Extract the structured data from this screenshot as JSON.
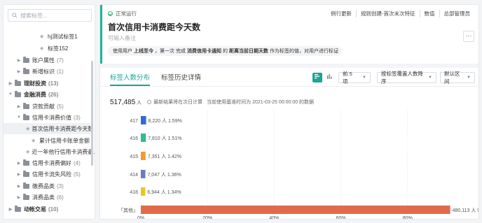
{
  "sidebar": {
    "search_placeholder": "搜索标签...",
    "items": [
      {
        "label": "hj测试标签1",
        "count": "",
        "type": "tag",
        "indent": 3
      },
      {
        "label": "标签152",
        "count": "",
        "type": "tag",
        "indent": 3
      },
      {
        "label": "账户属性",
        "count": "(7)",
        "type": "folder",
        "indent": 1
      },
      {
        "label": "新增标识",
        "count": "(1)",
        "type": "folder",
        "indent": 1
      },
      {
        "label": "理财投资",
        "count": "(13)",
        "type": "folder",
        "indent": 0,
        "bold": true
      },
      {
        "label": "金融消费",
        "count": "(26)",
        "type": "folder",
        "indent": 0,
        "bold": true,
        "expanded": true
      },
      {
        "label": "贷款贡献",
        "count": "(5)",
        "type": "folder",
        "indent": 1
      },
      {
        "label": "信用卡消费价值",
        "count": "(3)",
        "type": "folder",
        "indent": 1,
        "expanded": true
      },
      {
        "label": "首次信用卡消费距今天数",
        "count": "",
        "type": "tag",
        "indent": 2,
        "active": true
      },
      {
        "label": "累计信用卡账单金额",
        "count": "",
        "type": "tag",
        "indent": 2
      },
      {
        "label": "近一年他行信用卡消费最...",
        "count": "",
        "type": "tag",
        "indent": 2
      },
      {
        "label": "信用卡消费偏好",
        "count": "(4)",
        "type": "folder",
        "indent": 1
      },
      {
        "label": "信用卡流失风险",
        "count": "(5)",
        "type": "folder",
        "indent": 1
      },
      {
        "label": "缴费品类",
        "count": "(3)",
        "type": "folder",
        "indent": 1
      },
      {
        "label": "消费品类",
        "count": "(6)",
        "type": "folder",
        "indent": 1
      },
      {
        "label": "动帐交易",
        "count": "(10)",
        "type": "folder",
        "indent": 0,
        "bold": true
      }
    ]
  },
  "header": {
    "status": "正常运行",
    "links": [
      "例行更新",
      "规则创建-首次末次特征",
      "数值",
      "总部管理员"
    ],
    "title": "首次信用卡消费距今天数",
    "remark_placeholder": "可输入备注",
    "more": "···",
    "description": {
      "p1": "使用用户",
      "b1": "上线至今",
      "p2": "，第一次 完成",
      "b2": "消费信用卡通知",
      "p3": "的",
      "b3": "距离当前日期天数",
      "p4": "作为标签的值，对用户进行标记"
    }
  },
  "tabs": [
    {
      "label": "标签人数分布",
      "active": true
    },
    {
      "label": "标签历史详情",
      "active": false
    }
  ],
  "toolbar": {
    "bar_icon": "bar-chart-icon",
    "line_icon": "line-chart-icon",
    "topn": "前 5 项",
    "sort": "按标签覆盖人数降序",
    "range": "默认区间"
  },
  "summary": {
    "total": "517,485",
    "unit": "人",
    "note1": "最新结果将在次日计算",
    "note2": "当前使用基准时间为 2021-03-25 00:00:00 的数据"
  },
  "chart_data": {
    "type": "bar",
    "orientation": "horizontal",
    "categories": [
      "417",
      "416",
      "415",
      "414",
      "418",
      "「其他」"
    ],
    "values": [
      8220,
      7810,
      7351,
      7047,
      6944,
      480113
    ],
    "percents": [
      1.59,
      1.51,
      1.42,
      1.36,
      1.34,
      92.78
    ],
    "labels": [
      "8,220 人 1.59%",
      "7,810 人 1.51%",
      "7,351 人 1.42%",
      "7,047 人 1.36%",
      "6,944 人 1.34%",
      "480,113 人 92.78%"
    ],
    "colors": [
      "#2f6bd8",
      "#2cbf86",
      "#f39a2e",
      "#6e7bbf",
      "#e8c91c",
      "#e06b4b"
    ],
    "x_ticks": [
      "0%",
      "20%",
      "40%",
      "60%",
      "80%"
    ],
    "xlim": [
      0,
      100
    ]
  }
}
